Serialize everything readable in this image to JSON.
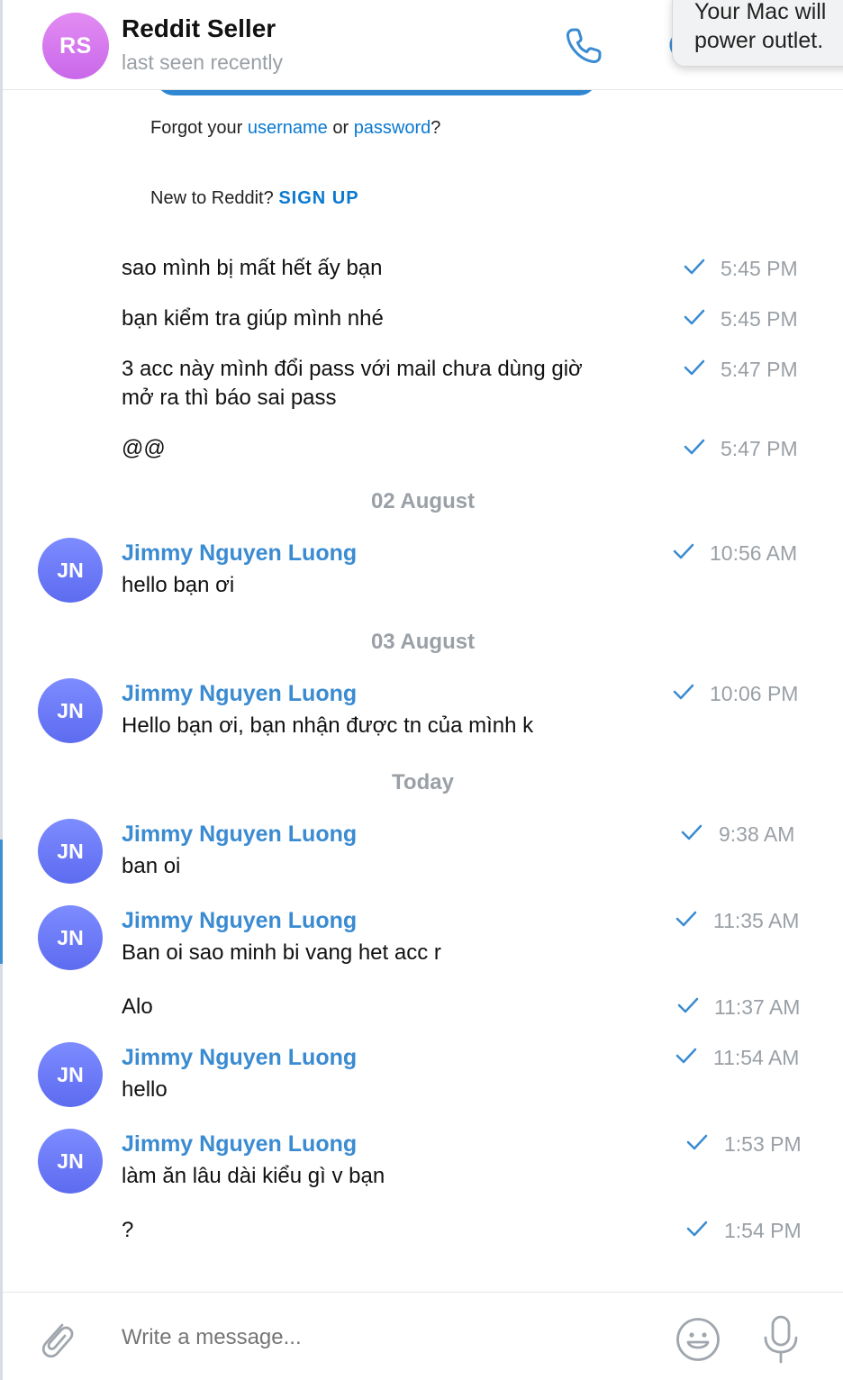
{
  "header": {
    "avatar_initials": "RS",
    "title": "Reddit Seller",
    "status": "last seen recently"
  },
  "notification": {
    "line1": "Your Mac will",
    "line2": "power outlet."
  },
  "reddit_card": {
    "forgot_prefix": "Forgot your",
    "username_link": "username",
    "or": "or",
    "password_link": "password",
    "forgot_suffix": "?",
    "new_prefix": "New to Reddit?",
    "signup": "SIGN UP"
  },
  "messages": [
    {
      "text": "sao mình bị mất hết ấy bạn",
      "time": "5:45 PM"
    },
    {
      "text": "bạn kiểm tra giúp mình nhé",
      "time": "5:45 PM"
    },
    {
      "text": "3 acc này mình đổi pass với mail chưa dùng giờ",
      "text2": "mở ra thì báo sai pass",
      "time": "5:47 PM"
    },
    {
      "text": "@@",
      "time": "5:47 PM"
    },
    {
      "sender": "Jimmy Nguyen Luong",
      "avatar": "JN",
      "text": "hello bạn ơi",
      "time": "10:56 AM"
    },
    {
      "sender": "Jimmy Nguyen Luong",
      "avatar": "JN",
      "text": "Hello bạn ơi, bạn nhận được tn của mình k",
      "time": "10:06 PM"
    },
    {
      "sender": "Jimmy Nguyen Luong",
      "avatar": "JN",
      "text": "ban oi",
      "time": "9:38 AM"
    },
    {
      "sender": "Jimmy Nguyen Luong",
      "avatar": "JN",
      "text": "Ban oi sao minh bi vang het acc r",
      "time": "11:35 AM"
    },
    {
      "text": "Alo",
      "time": "11:37 AM"
    },
    {
      "sender": "Jimmy Nguyen Luong",
      "avatar": "JN",
      "text": "hello",
      "time": "11:54 AM"
    },
    {
      "sender": "Jimmy Nguyen Luong",
      "avatar": "JN",
      "text": "làm ăn lâu dài kiểu gì v bạn",
      "time": "1:53 PM"
    },
    {
      "text": "?",
      "time": "1:54 PM"
    }
  ],
  "date_separators": [
    "02 August",
    "03 August",
    "Today"
  ],
  "composer": {
    "placeholder": "Write a message..."
  },
  "colors": {
    "accent": "#3a8bd1",
    "check": "#3a8bd1",
    "muted": "#9aa0a6"
  }
}
